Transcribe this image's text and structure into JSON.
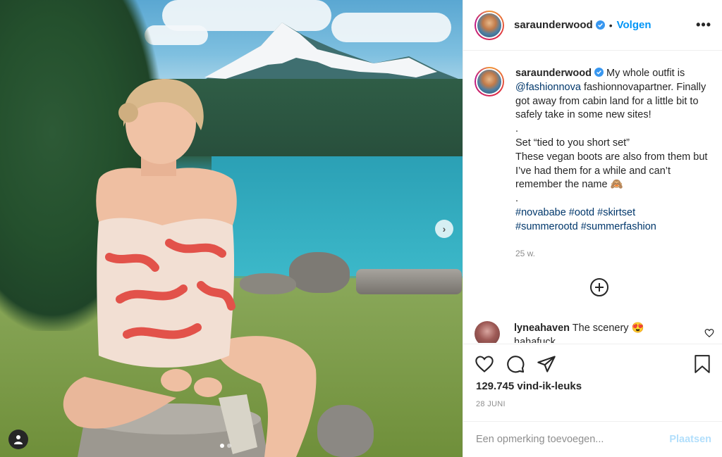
{
  "post": {
    "username": "saraunderwood",
    "follow_label": "Volgen",
    "bullet": "•",
    "more_icon": "more-horizontal-icon",
    "media_alt": "Woman in tie-dye outfit sitting on a log in a meadow by a lake with a snowy mountain behind",
    "carousel_dots": 2
  },
  "caption": {
    "username": "saraunderwood",
    "line1": " My whole outfit is ",
    "mention": "@fashionnova",
    "line1b": " fashionnovapartner. Finally got away from cabin land for a little bit to safely take in some new sites!",
    "dot1": ".",
    "line2": "Set “tied to you short set”",
    "line3": "These vegan boots are also from them but I’ve had them for a while and can’t remember the name 🙈",
    "dot2": ".",
    "hashtags": [
      "#novababe",
      "#ootd",
      "#skirtset",
      "#summerootd",
      "#summerfashion"
    ],
    "time": "25 w."
  },
  "comment": {
    "username": "lyneahaven",
    "text": " The scenery 😍",
    "overflow_text": "hahafuck"
  },
  "actions": {
    "likes": "129.745 vind-ik-leuks",
    "date": "28 JUNI"
  },
  "add_comment": {
    "placeholder": "Een opmerking toevoegen...",
    "post_label": "Plaatsen"
  },
  "colors": {
    "accent": "#0095f6",
    "link": "#00376b",
    "muted": "#8e8e8e",
    "post_disabled": "#b2dffc"
  }
}
